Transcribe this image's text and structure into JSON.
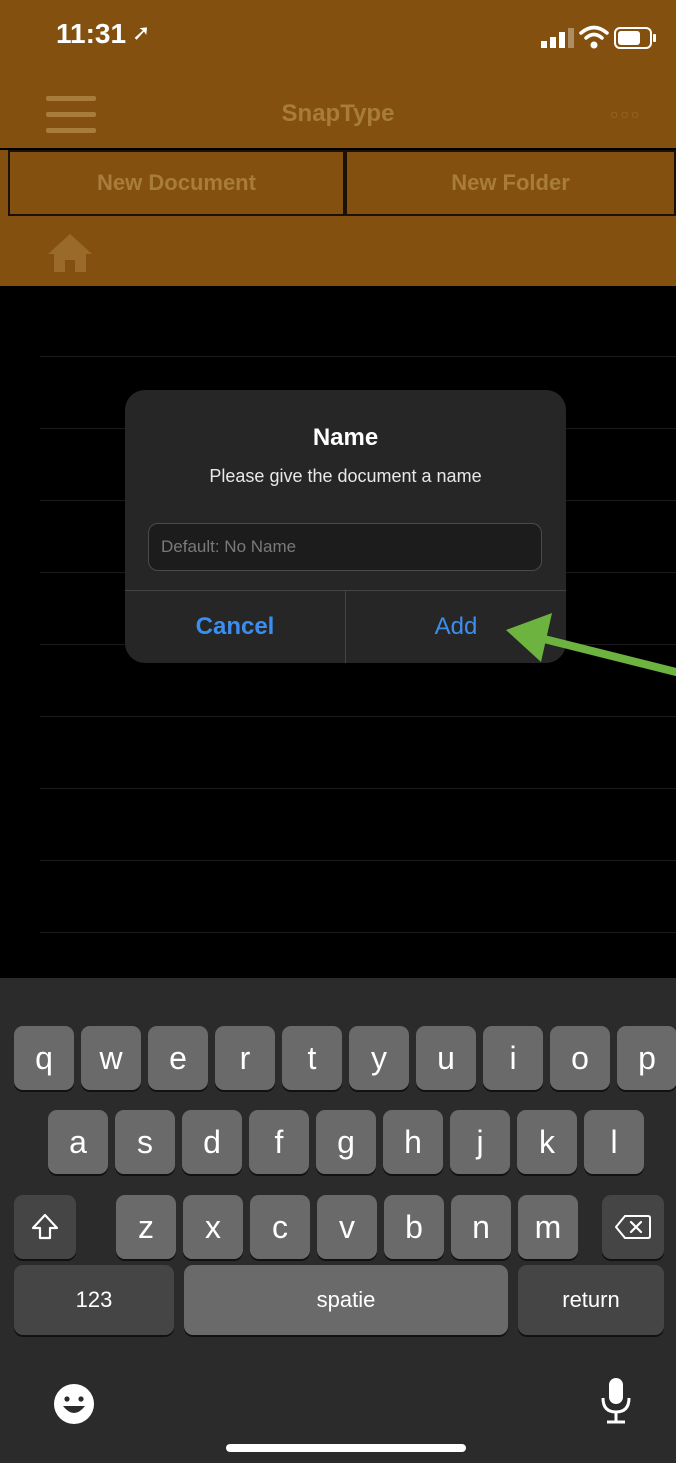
{
  "status_bar": {
    "time": "11:31",
    "location_glyph": "➚"
  },
  "app": {
    "title": "SnapType",
    "more_glyph": "○○○"
  },
  "toolbar": {
    "new_document": "New Document",
    "new_folder": "New Folder"
  },
  "dialog": {
    "title": "Name",
    "message": "Please give the document a name",
    "input_placeholder": "Default: No Name",
    "input_value": "",
    "cancel_label": "Cancel",
    "add_label": "Add"
  },
  "annotation": {
    "arrow_color": "#6db33f",
    "points_to": "add-button"
  },
  "keyboard": {
    "row1": [
      "q",
      "w",
      "e",
      "r",
      "t",
      "y",
      "u",
      "i",
      "o",
      "p"
    ],
    "row2": [
      "a",
      "s",
      "d",
      "f",
      "g",
      "h",
      "j",
      "k",
      "l"
    ],
    "row3": [
      "z",
      "x",
      "c",
      "v",
      "b",
      "n",
      "m"
    ],
    "numbers_key": "123",
    "space_key": "spatie",
    "return_key": "return"
  },
  "colors": {
    "brand": "#84500f",
    "dialog_button": "#3b8ef0",
    "keyboard_bg": "#2b2b2b"
  }
}
